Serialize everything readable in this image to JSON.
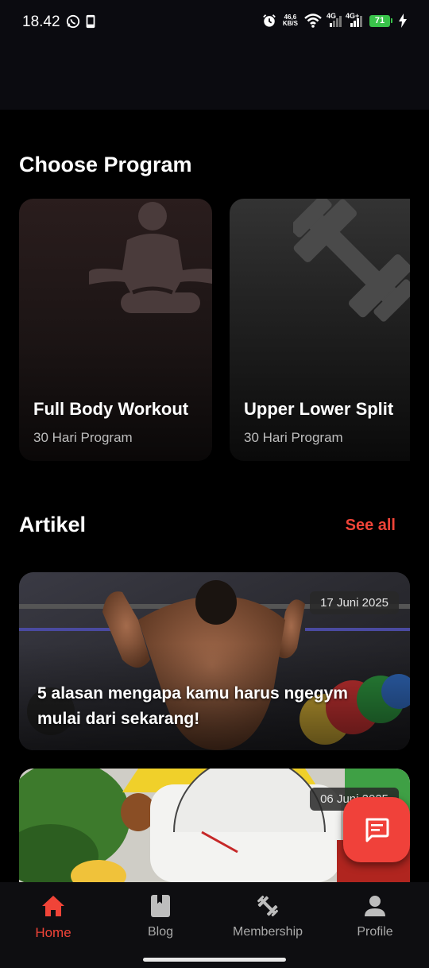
{
  "status_bar": {
    "time": "18.42",
    "net_speed_value": "46,6",
    "net_speed_unit": "KB/S",
    "signal_1_label": "4G",
    "signal_2_label": "4G+",
    "battery": "71",
    "icons": [
      "whatsapp-icon",
      "phone-icon",
      "alarm-icon",
      "wifi-icon",
      "signal-icon",
      "battery-icon",
      "charging-icon"
    ]
  },
  "programs": {
    "title": "Choose Program",
    "cards": [
      {
        "title": "Full Body Workout",
        "subtitle": "30 Hari Program",
        "icon": "meditation-icon"
      },
      {
        "title": "Upper Lower Split",
        "subtitle": "30 Hari Program",
        "icon": "dumbbell-icon"
      }
    ]
  },
  "articles": {
    "title": "Artikel",
    "see_all": "See all",
    "items": [
      {
        "date": "17 Juni 2025",
        "title": "5 alasan mengapa kamu harus ngegym mulai dari sekarang!"
      },
      {
        "date": "06 Juni 2025",
        "title": ""
      }
    ]
  },
  "nav": {
    "items": [
      {
        "label": "Home",
        "icon": "home-icon",
        "active": true
      },
      {
        "label": "Blog",
        "icon": "book-icon",
        "active": false
      },
      {
        "label": "Membership",
        "icon": "dumbbell-icon",
        "active": false
      },
      {
        "label": "Profile",
        "icon": "person-icon",
        "active": false
      }
    ]
  },
  "colors": {
    "accent": "#f04438",
    "fab": "#f0413a",
    "background": "#000000",
    "nav_background": "#0e0e11"
  }
}
